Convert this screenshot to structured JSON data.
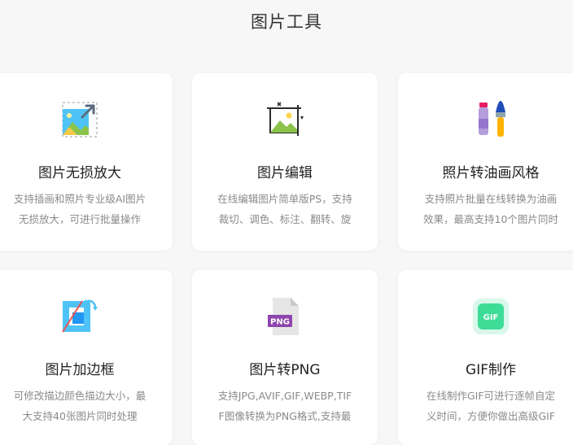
{
  "section": {
    "title": "图片工具"
  },
  "cards": [
    {
      "title": "图片无损放大",
      "desc": [
        "支持插画和照片专业级AI图片",
        "无损放大，可进行批量操作"
      ],
      "icon": "image-upscale-icon"
    },
    {
      "title": "图片编辑",
      "desc": [
        "在线编辑图片简单版PS，支持",
        "裁切、调色、标注、翻转、旋"
      ],
      "icon": "image-edit-icon"
    },
    {
      "title": "照片转油画风格",
      "desc": [
        "支持照片批量在线转换为油画",
        "效果，最高支持10个图片同时"
      ],
      "icon": "paint-brush-icon"
    },
    {
      "title": "图片加边框",
      "desc": [
        "可修改描边颜色描边大小，最",
        "大支持40张图片同时处理"
      ],
      "icon": "image-border-icon"
    },
    {
      "title": "图片转PNG",
      "desc": [
        "支持JPG,AVIF,GIF,WEBP,TIF",
        "F图像转换为PNG格式,支持最"
      ],
      "icon": "png-file-icon",
      "icon_text": "PNG"
    },
    {
      "title": "GIF制作",
      "desc": [
        "在线制作GIF可进行逐帧自定",
        "义时间，方便你做出高级GIF"
      ],
      "icon": "gif-icon",
      "icon_text": "GIF"
    }
  ],
  "colors": {
    "page_bg": "#f7f7f8",
    "card_bg": "#ffffff",
    "title": "#222222",
    "desc": "#8a8a8a"
  }
}
